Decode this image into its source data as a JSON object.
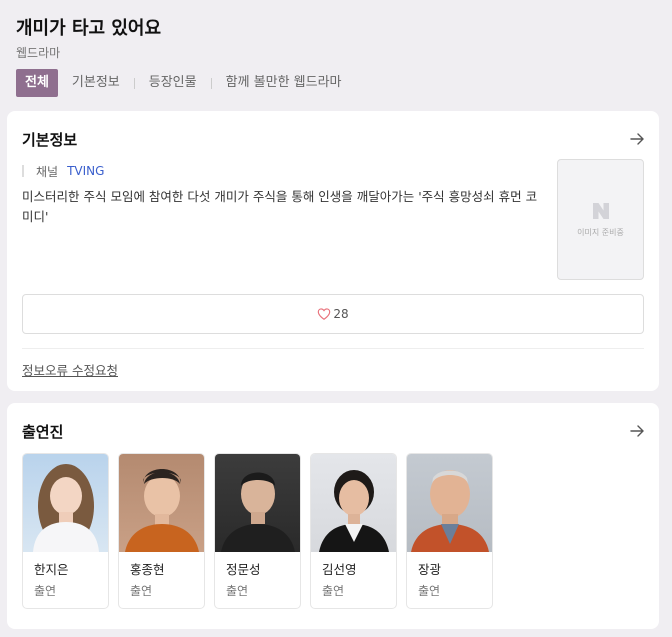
{
  "header": {
    "title": "개미가 타고 있어요",
    "subtitle": "웹드라마",
    "tabs": [
      {
        "label": "전체",
        "active": true
      },
      {
        "label": "기본정보",
        "active": false
      },
      {
        "label": "등장인물",
        "active": false
      },
      {
        "label": "함께 볼만한 웹드라마",
        "active": false
      }
    ]
  },
  "basic_info": {
    "title": "기본정보",
    "channel_label": "채널",
    "channel_value": "TVING",
    "description": "미스터리한 주식 모임에 참여한 다섯 개미가 주식을 통해 인생을 깨달아가는 '주식 흥망성쇠 휴먼 코미디'",
    "poster_placeholder": "이미지 준비중",
    "like_count": "28",
    "report_link": "정보오류 수정요청"
  },
  "cast": {
    "title": "출연진",
    "members": [
      {
        "name": "한지은",
        "role": "출연"
      },
      {
        "name": "홍종현",
        "role": "출연"
      },
      {
        "name": "정문성",
        "role": "출연"
      },
      {
        "name": "김선영",
        "role": "출연"
      },
      {
        "name": "장광",
        "role": "출연"
      }
    ]
  },
  "colors": {
    "accent": "#8f6f8f",
    "link": "#3a5fcd",
    "heart": "#e8707a",
    "background": "#f0eef2"
  }
}
